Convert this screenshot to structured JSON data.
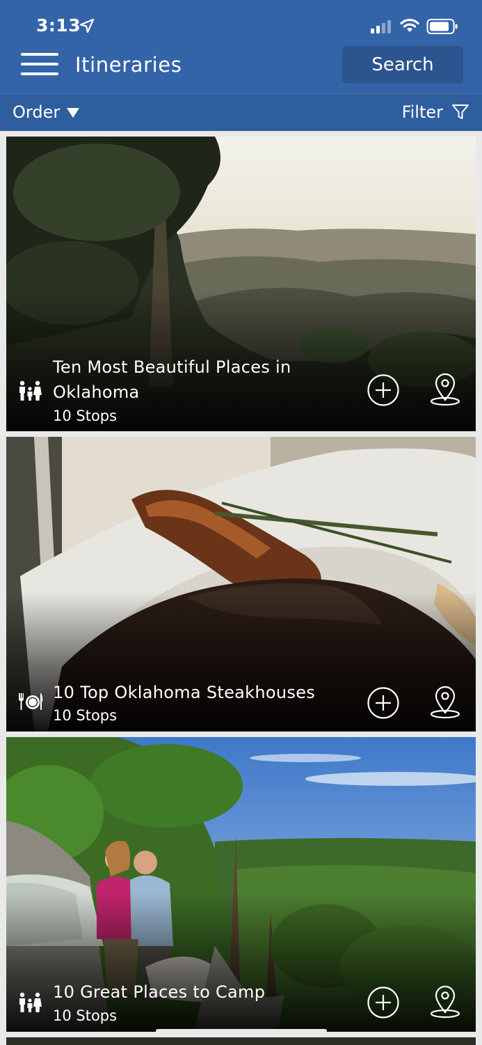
{
  "status_bar": {
    "time": "3:13",
    "icons": [
      "location-arrow-icon",
      "cellular-signal-icon",
      "wifi-icon",
      "battery-icon"
    ]
  },
  "header": {
    "title": "Itineraries",
    "search_label": "Search",
    "menu_icon": "hamburger-menu-icon",
    "color": "#3464a8"
  },
  "toolbar": {
    "order_label": "Order",
    "filter_label": "Filter"
  },
  "cards": [
    {
      "title": "Ten Most Beautiful Places in Oklahoma",
      "stops": "10 Stops",
      "category_icon": "family-icon",
      "scene": "mountain overlook at sunset"
    },
    {
      "title": "10 Top Oklahoma Steakhouses",
      "stops": "10 Stops",
      "category_icon": "dining-icon",
      "scene": "steak with rosemary"
    },
    {
      "title": "10 Great Places to Camp",
      "stops": "10 Stops",
      "category_icon": "family-icon",
      "scene": "couple with dog at campsite"
    }
  ]
}
